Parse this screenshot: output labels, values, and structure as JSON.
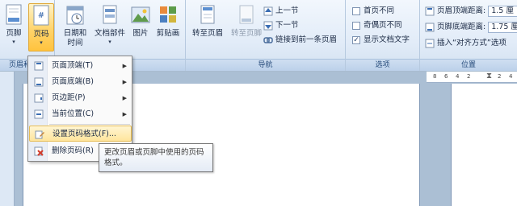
{
  "ribbon": {
    "groups": {
      "header_footer": {
        "label": "页眉和页脚",
        "footer_btn": "页脚",
        "page_number_btn": "页码"
      },
      "insert": {
        "datetime_btn": "日期和\n时间",
        "quickparts_btn": "文档部件",
        "picture_btn": "图片",
        "clipart_btn": "剪贴画"
      },
      "navigation": {
        "label": "导航",
        "goto_header": "转至页眉",
        "goto_footer": "转至页脚",
        "prev_section": "上一节",
        "next_section": "下一节",
        "link_previous": "链接到前一条页眉"
      },
      "options": {
        "label": "选项",
        "different_first": "首页不同",
        "different_odd_even": "奇偶页不同",
        "show_doc_text": "显示文档文字",
        "show_doc_text_checked": true
      },
      "position": {
        "label": "位置",
        "header_top_label": "页眉顶端距离:",
        "header_top_value": "1.5 厘",
        "footer_bottom_label": "页脚底端距离:",
        "footer_bottom_value": "1.75 厘",
        "insert_align_tab": "插入“对齐方式”选项"
      }
    }
  },
  "ruler": {
    "ticks": [
      "8",
      "6",
      "4",
      "2",
      "2",
      "4"
    ]
  },
  "menu": {
    "items": [
      {
        "label": "页面顶端(T)",
        "submenu": true
      },
      {
        "label": "页面底端(B)",
        "submenu": true
      },
      {
        "label": "页边距(P)",
        "submenu": true
      },
      {
        "label": "当前位置(C)",
        "submenu": true
      },
      {
        "label": "设置页码格式(F)...",
        "submenu": false
      },
      {
        "label": "删除页码(R)",
        "submenu": false
      }
    ]
  },
  "tooltip": {
    "text": "更改页眉或页脚中使用的页码格式。"
  },
  "colors": {
    "ribbon_bg": "#e2ecf8",
    "highlight": "#ffe59c",
    "workspace": "#abbfd4"
  }
}
